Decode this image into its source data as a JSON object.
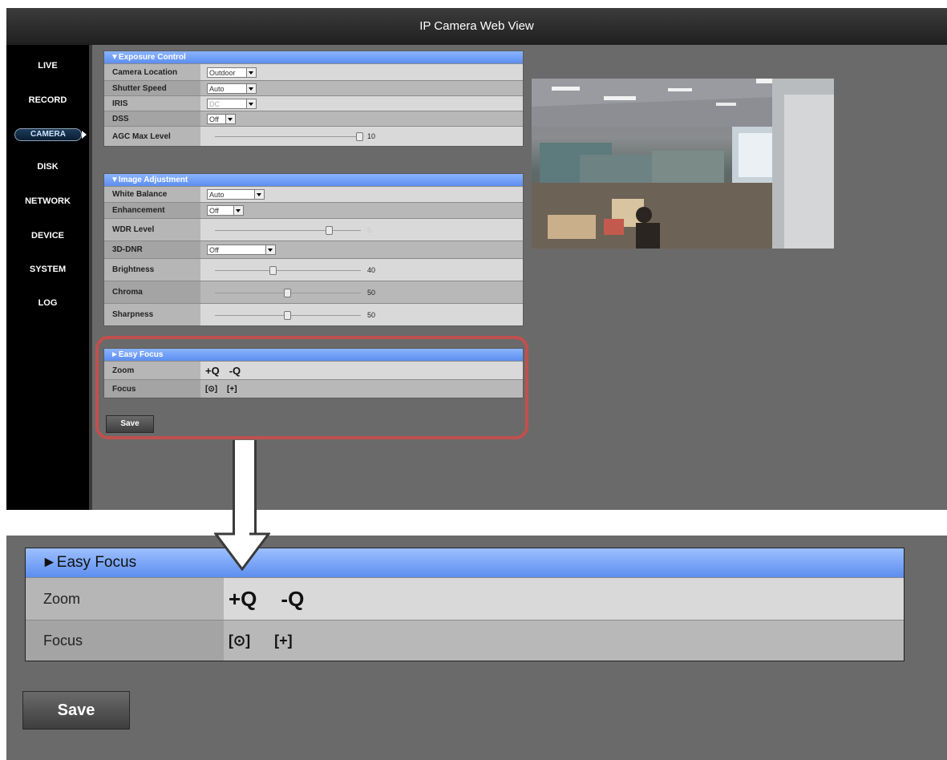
{
  "app": {
    "title": "IP Camera Web View"
  },
  "sidebar": {
    "items": [
      {
        "label": "LIVE"
      },
      {
        "label": "RECORD"
      },
      {
        "label": "CAMERA"
      },
      {
        "label": "DISK"
      },
      {
        "label": "NETWORK"
      },
      {
        "label": "DEVICE"
      },
      {
        "label": "SYSTEM"
      },
      {
        "label": "LOG"
      }
    ],
    "active": "CAMERA"
  },
  "exposure": {
    "header": "▼Exposure Control",
    "camera_location": {
      "label": "Camera Location",
      "value": "Outdoor"
    },
    "shutter_speed": {
      "label": "Shutter Speed",
      "value": "Auto"
    },
    "iris": {
      "label": "IRIS",
      "value": "DC"
    },
    "dss": {
      "label": "DSS",
      "value": "Off"
    },
    "agc": {
      "label": "AGC Max Level",
      "value": "10"
    }
  },
  "image": {
    "header": "▼Image Adjustment",
    "white_balance": {
      "label": "White Balance",
      "value": "Auto"
    },
    "enhancement": {
      "label": "Enhancement",
      "value": "Off"
    },
    "wdr": {
      "label": "WDR Level",
      "value": "5"
    },
    "dnr": {
      "label": "3D-DNR",
      "value": "Off"
    },
    "brightness": {
      "label": "Brightness",
      "value": "40"
    },
    "chroma": {
      "label": "Chroma",
      "value": "50"
    },
    "sharpness": {
      "label": "Sharpness",
      "value": "50"
    }
  },
  "easy_focus": {
    "header": "►Easy Focus",
    "zoom_label": "Zoom",
    "focus_label": "Focus",
    "zoom_in_glyph": "+Q",
    "zoom_out_glyph": "-Q",
    "focus_auto_glyph": "[⊙]",
    "focus_near_glyph": "[+]"
  },
  "save_label": "Save",
  "zoomed": {
    "header": "►Easy Focus",
    "zoom_label": "Zoom",
    "focus_label": "Focus",
    "save_label": "Save"
  },
  "colors": {
    "panel_header": "#5d8eef",
    "highlight": "#c0504d"
  }
}
